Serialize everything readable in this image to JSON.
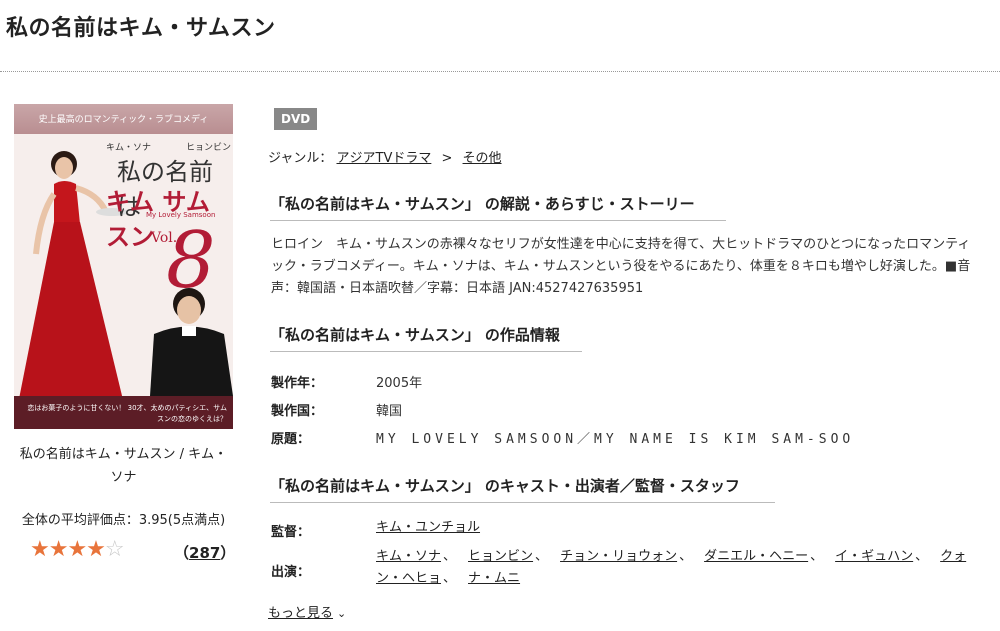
{
  "page": {
    "title": "私の名前はキム・サムスン"
  },
  "cover": {
    "tagline": "史上最高のロマンティック・ラブコメディ",
    "name_a": "キム・ソナ",
    "name_b": "ヒョンビン",
    "title_line1": "私の名前は",
    "title_line2": "キム サムスン",
    "subtitle": "My Lovely Samsoon",
    "vol_label": "Vol.",
    "vol_number": "8",
    "footer_text": "恋はお菓子のように甘くない！ 30才、太めのパティシエ、サムスンの恋のゆくえは？"
  },
  "caption": "私の名前はキム・サムスン / キム・ソナ",
  "rating": {
    "label": "全体の平均評価点：3.95(5点満点)",
    "filled_stars": "★★★★",
    "empty_stars": "☆",
    "score": 3.95,
    "count": "287",
    "count_prefix": "（",
    "count_suffix": "）"
  },
  "badge": "DVD",
  "genre": {
    "label": "ジャンル：",
    "items": [
      "アジアTVドラマ",
      "その他"
    ],
    "sep": ">"
  },
  "synopsis": {
    "heading": "「私の名前はキム・サムスン」 の解説・あらすじ・ストーリー",
    "text": "ヒロイン　キム・サムスンの赤裸々なセリフが女性達を中心に支持を得て、大ヒットドラマのひとつになったロマンティック・ラブコメディー。キム・ソナは、キム・サムスンという役をやるにあたり、体重を８キロも増やし好演した。■音声：韓国語・日本語吹替／字幕：日本語 JAN:4527427635951"
  },
  "info": {
    "heading": "「私の名前はキム・サムスン」 の作品情報",
    "rows": [
      {
        "label": "製作年：",
        "value": "2005年"
      },
      {
        "label": "製作国：",
        "value": "韓国"
      },
      {
        "label": "原題：",
        "value": "MY LOVELY SAMSOON／MY NAME IS KIM SAM-SOO"
      }
    ]
  },
  "cast": {
    "heading": "「私の名前はキム・サムスン」 のキャスト・出演者／監督・スタッフ",
    "director_label": "監督：",
    "director": "キム・ユンチョル",
    "actors_label": "出演：",
    "actors": [
      "キム・ソナ",
      "ヒョンビン",
      "チョン・リョウォン",
      "ダニエル・ヘニー",
      "イ・ギュハン",
      "クォン・ヘヒョ",
      "ナ・ムニ"
    ],
    "comma": "、"
  },
  "more": {
    "label": "もっと見る"
  }
}
